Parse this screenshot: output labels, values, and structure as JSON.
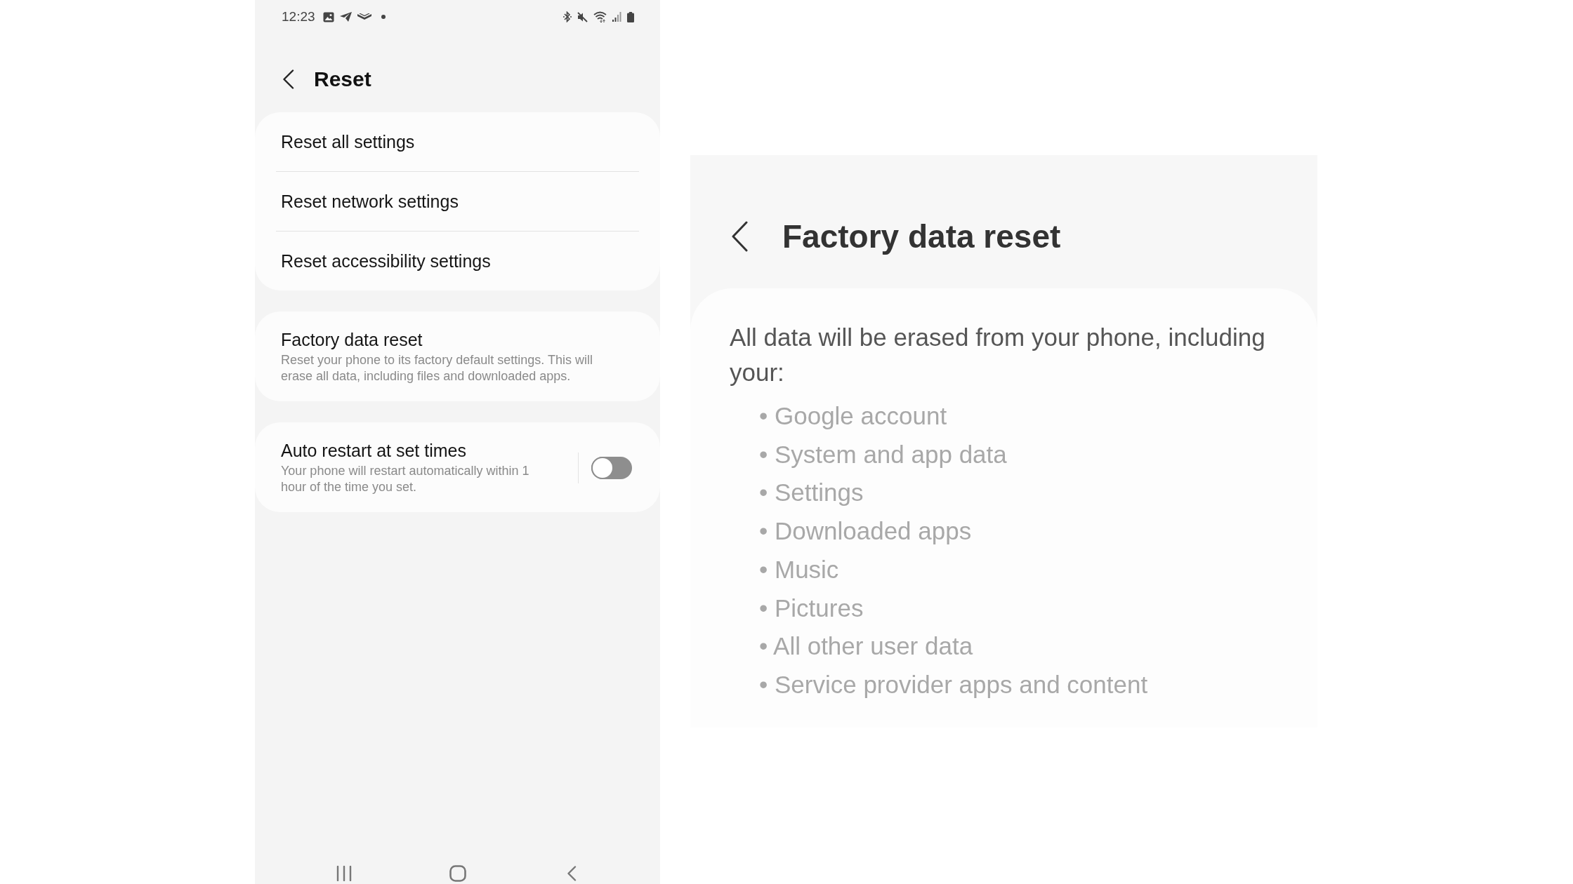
{
  "phone": {
    "status_bar": {
      "time": "12:23"
    },
    "header": {
      "title": "Reset"
    },
    "groups": [
      {
        "items": [
          {
            "kind": "link",
            "title": "Reset all settings"
          },
          {
            "kind": "link",
            "title": "Reset network settings"
          },
          {
            "kind": "link",
            "title": "Reset accessibility settings"
          }
        ]
      },
      {
        "items": [
          {
            "kind": "link",
            "title": "Factory data reset",
            "subtitle": "Reset your phone to its factory default settings. This will erase all data, including files and downloaded apps."
          }
        ]
      },
      {
        "items": [
          {
            "kind": "toggle",
            "title": "Auto restart at set times",
            "subtitle": "Your phone will restart automatically within 1 hour of the time you set.",
            "on": false
          }
        ]
      }
    ]
  },
  "detail": {
    "title": "Factory data reset",
    "intro": "All data will be erased from your phone, including your:",
    "items": [
      "• Google account",
      "• System and app data",
      "• Settings",
      "• Downloaded apps",
      "• Music",
      "• Pictures",
      "• All other user data",
      "• Service provider apps and content"
    ]
  }
}
